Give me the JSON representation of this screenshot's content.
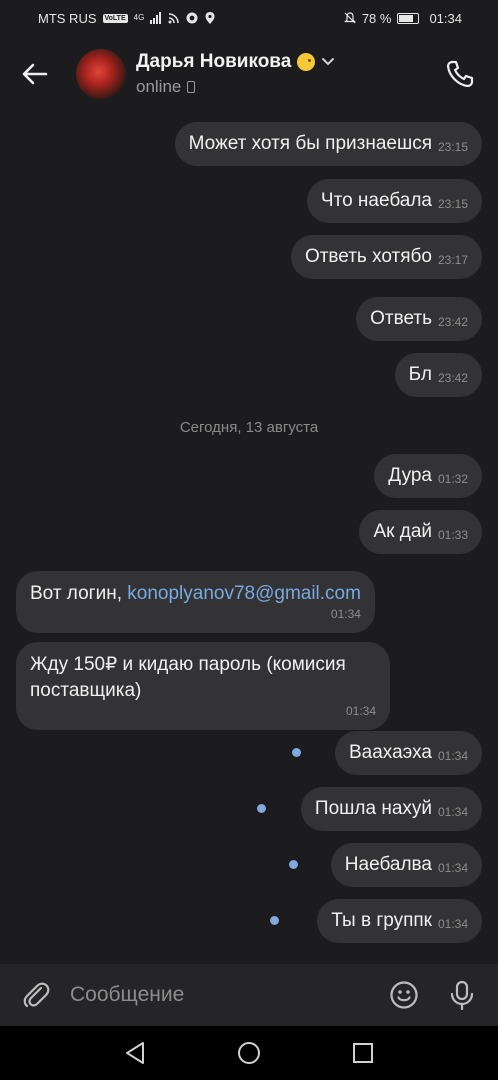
{
  "status_bar": {
    "carrier": "MTS RUS",
    "volte": "VoLTE",
    "network": "4G",
    "battery": "78 %",
    "battery_level": 0.78,
    "time": "01:34"
  },
  "header": {
    "name": "Дарья Новикова",
    "status": "online"
  },
  "messages": [
    {
      "dir": "out",
      "text": "Может хотя бы признаешся",
      "time": "23:15"
    },
    {
      "dir": "out",
      "text": "Что наебала",
      "time": "23:15"
    },
    {
      "dir": "out",
      "text": "Ответь хотябо",
      "time": "23:17"
    },
    {
      "dir": "out",
      "text": "Ответь",
      "time": "23:42"
    },
    {
      "dir": "out",
      "text": "Бл",
      "time": "23:42"
    },
    {
      "dir": "out",
      "text": "Дура",
      "time": "01:32"
    },
    {
      "dir": "out",
      "text": "Ак дай",
      "time": "01:33"
    },
    {
      "dir": "in",
      "prefix": "Вот логин, ",
      "link": "konoplyanov78@gmail.com",
      "time": "01:34"
    },
    {
      "dir": "in",
      "text": "Жду 150₽ и кидаю пароль (комисия поставщика)",
      "time": "01:34"
    },
    {
      "dir": "out",
      "text": "Ваахаэха",
      "time": "01:34",
      "unread": true
    },
    {
      "dir": "out",
      "text": "Пошла нахуй",
      "time": "01:34",
      "unread": true
    },
    {
      "dir": "out",
      "text": "Наебалва",
      "time": "01:34",
      "unread": true
    },
    {
      "dir": "out",
      "text": "Ты в группк",
      "time": "01:34",
      "unread": true
    }
  ],
  "date_separator": "Сегодня, 13 августа",
  "input": {
    "placeholder": "Сообщение"
  },
  "colors": {
    "background": "#1c1c1e",
    "bubble": "#333335",
    "link": "#78a9e0",
    "unread_dot": "#82a8e0"
  }
}
